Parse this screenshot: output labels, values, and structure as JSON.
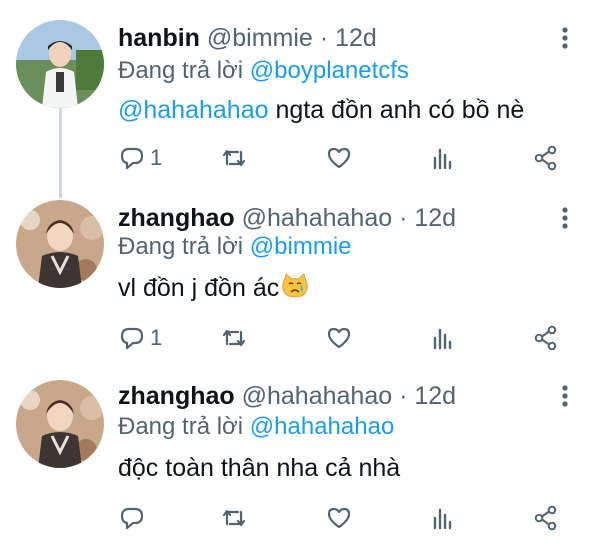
{
  "tweets": [
    {
      "name": "hanbin",
      "handle": "@bimmie",
      "separator": "·",
      "time": "12d",
      "replying_prefix": "Đang trả lời",
      "replying_to": "@boyplanetcfs",
      "mention": "@hahahahao",
      "text": "ngta đồn anh có bồ nè",
      "reply_count": "1"
    },
    {
      "name": "zhanghao",
      "handle": "@hahahahao",
      "separator": "·",
      "time": "12d",
      "replying_prefix": "Đang trả lời",
      "replying_to": "@bimmie",
      "text": "vl đồn j đồn ác",
      "emoji": "crying-cat-emoji",
      "reply_count": "1"
    },
    {
      "name": "zhanghao",
      "handle": "@hahahahao",
      "separator": "·",
      "time": "12d",
      "replying_prefix": "Đang trả lời",
      "replying_to": "@hahahahao",
      "text": "độc toàn thân nha cả nhà",
      "reply_count": ""
    }
  ],
  "icons": [
    "reply-icon",
    "retweet-icon",
    "like-icon",
    "views-icon",
    "share-icon",
    "more-icon"
  ],
  "colors": {
    "link": "#1d9bf0",
    "secondary": "#536471",
    "text": "#0f1419",
    "thread_line": "#cfd9de"
  }
}
